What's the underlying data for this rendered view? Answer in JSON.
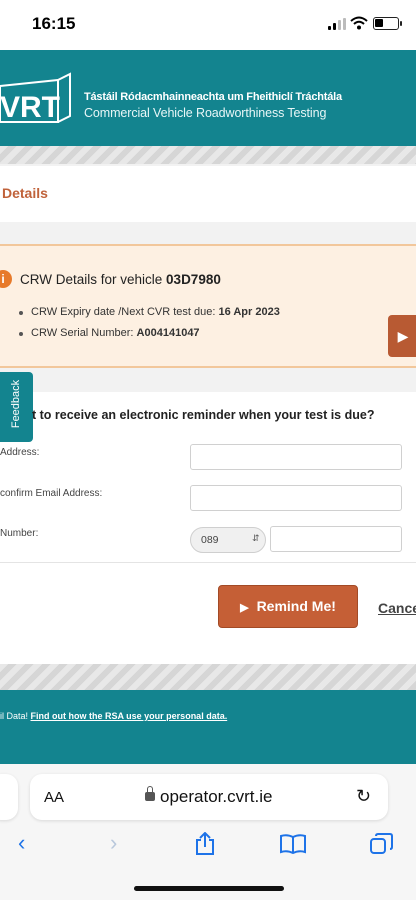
{
  "status_bar": {
    "time": "16:15"
  },
  "header": {
    "logo_text": "VRT",
    "org_irish": "Tástáil Ródacmhainneachta um Fheithiclí Tráchtála",
    "org_english": "Commercial Vehicle Roadworthiness Testing"
  },
  "section": {
    "title": "Details"
  },
  "info_panel": {
    "title_prefix": "CRW Details for vehicle ",
    "vehicle_reg": "03D7980",
    "expiry_label": "CRW Expiry date /Next CVR test due: ",
    "expiry_value": "16 Apr 2023",
    "serial_label": "CRW Serial Number: ",
    "serial_value": "A004141047",
    "arrow_icon": "play-arrow-icon"
  },
  "feedback_tab": {
    "label": "Feedback"
  },
  "form": {
    "question": "t to receive an electronic reminder when your test is due?",
    "email_label": "Address:",
    "confirm_email_label": "confirm Email Address:",
    "phone_label": "Number:",
    "phone_prefix": "089",
    "email_value": "",
    "confirm_email_value": "",
    "phone_value": ""
  },
  "actions": {
    "remind_label": "Remind Me!",
    "cancel_label": "Cance"
  },
  "footer": {
    "prefix": "il Data! ",
    "link": "Find out how the RSA use your personal data."
  },
  "browser": {
    "text_size_label": "AA",
    "url": "operator.cvrt.ie"
  },
  "colors": {
    "teal": "#13848f",
    "accent": "#c55f36",
    "info_bg": "#fdf0e2"
  }
}
